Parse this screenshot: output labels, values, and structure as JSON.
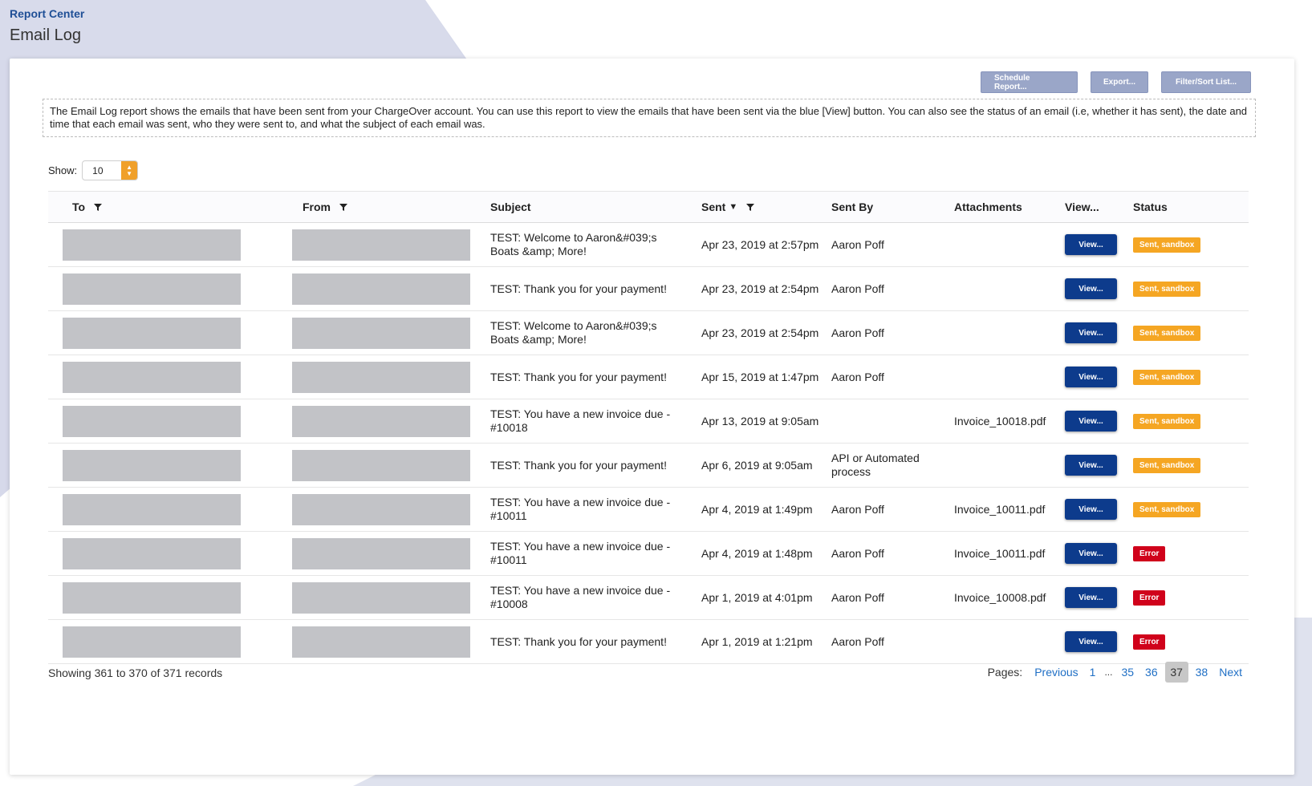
{
  "header": {
    "breadcrumb": "Report Center",
    "title": "Email Log"
  },
  "toolbar": {
    "schedule_label": "Schedule Report...",
    "export_label": "Export...",
    "filter_label": "Filter/Sort List..."
  },
  "info": {
    "text": "The Email Log report shows the emails that have been sent from your ChargeOver account. You can use this report to view the emails that have been sent via the blue [View] button. You can also see the status of an email (i.e, whether it has sent), the date and time that each email was sent, who they were sent to, and what the subject of each email was."
  },
  "show": {
    "label": "Show:",
    "value": "10"
  },
  "columns": {
    "to": "To",
    "from": "From",
    "subject": "Subject",
    "sent": "Sent",
    "sent_by": "Sent By",
    "attachments": "Attachments",
    "view": "View...",
    "status": "Status"
  },
  "rows": [
    {
      "subject": "TEST: Welcome to Aaron&#039;s Boats &amp; More!",
      "sent": "Apr 23, 2019 at 2:57pm",
      "sent_by": "Aaron Poff",
      "attachment": "",
      "view": "View...",
      "status": "Sent, sandbox",
      "status_type": "sent"
    },
    {
      "subject": "TEST: Thank you for your payment!",
      "sent": "Apr 23, 2019 at 2:54pm",
      "sent_by": "Aaron Poff",
      "attachment": "",
      "view": "View...",
      "status": "Sent, sandbox",
      "status_type": "sent"
    },
    {
      "subject": "TEST: Welcome to Aaron&#039;s Boats &amp; More!",
      "sent": "Apr 23, 2019 at 2:54pm",
      "sent_by": "Aaron Poff",
      "attachment": "",
      "view": "View...",
      "status": "Sent, sandbox",
      "status_type": "sent"
    },
    {
      "subject": "TEST: Thank you for your payment!",
      "sent": "Apr 15, 2019 at 1:47pm",
      "sent_by": "Aaron Poff",
      "attachment": "",
      "view": "View...",
      "status": "Sent, sandbox",
      "status_type": "sent"
    },
    {
      "subject": "TEST: You have a new invoice due - #10018",
      "sent": "Apr 13, 2019 at 9:05am",
      "sent_by": "",
      "attachment": "Invoice_10018.pdf",
      "view": "View...",
      "status": "Sent, sandbox",
      "status_type": "sent"
    },
    {
      "subject": "TEST: Thank you for your payment!",
      "sent": "Apr 6, 2019 at 9:05am",
      "sent_by": "API or Automated process",
      "attachment": "",
      "view": "View...",
      "status": "Sent, sandbox",
      "status_type": "sent"
    },
    {
      "subject": "TEST: You have a new invoice due - #10011",
      "sent": "Apr 4, 2019 at 1:49pm",
      "sent_by": "Aaron Poff",
      "attachment": "Invoice_10011.pdf",
      "view": "View...",
      "status": "Sent, sandbox",
      "status_type": "sent"
    },
    {
      "subject": "TEST: You have a new invoice due - #10011",
      "sent": "Apr 4, 2019 at 1:48pm",
      "sent_by": "Aaron Poff",
      "attachment": "Invoice_10011.pdf",
      "view": "View...",
      "status": "Error",
      "status_type": "error"
    },
    {
      "subject": "TEST: You have a new invoice due - #10008",
      "sent": "Apr 1, 2019 at 4:01pm",
      "sent_by": "Aaron Poff",
      "attachment": "Invoice_10008.pdf",
      "view": "View...",
      "status": "Error",
      "status_type": "error"
    },
    {
      "subject": "TEST: Thank you for your payment!",
      "sent": "Apr 1, 2019 at 1:21pm",
      "sent_by": "Aaron Poff",
      "attachment": "",
      "view": "View...",
      "status": "Error",
      "status_type": "error"
    }
  ],
  "footer": {
    "count_text": "Showing 361 to 370 of 371 records"
  },
  "pagination": {
    "label": "Pages:",
    "previous": "Previous",
    "first": "1",
    "ellipsis": "...",
    "pages": [
      "35",
      "36"
    ],
    "current": "37",
    "after": [
      "38"
    ],
    "next": "Next"
  },
  "colors": {
    "accent": "#0d3b8c",
    "toolbar_button": "#9aa6c8",
    "status_sent": "#f5a623",
    "status_error": "#d0021b",
    "link": "#1f6fc5"
  }
}
